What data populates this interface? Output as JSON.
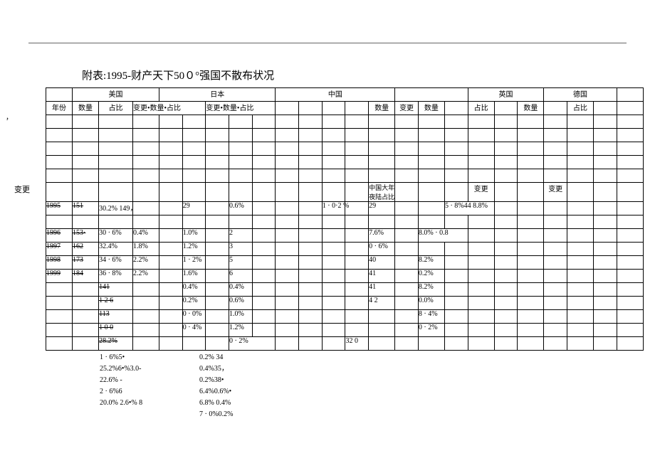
{
  "title": "附表:1995-财产天下50０°强国不散布状况",
  "side_label": "变更",
  "comma1": "，",
  "countries": {
    "us": "美国",
    "jp": "日本",
    "cn": "中国",
    "uk": "英国",
    "de": "德国"
  },
  "headers": {
    "year": "年份",
    "qty": "数量",
    "ratio": "占比",
    "chg_qty_ratio": "变更•数量•占比",
    "change": "变更"
  },
  "cn_block": "中国大年夜陆占比",
  "chart_data": {
    "type": "table",
    "title": "1995- 财产天下500强国不散布状况",
    "rows": [
      {
        "year": "1995",
        "us_qty": "151",
        "us_ratio": "30.2% 149，",
        "jp_a": "29",
        "jp_b": "0.6%",
        "mid": "1 · 0·2 %",
        "cn_qty": "29",
        "uk": "5 · 8%44 8.8%"
      },
      {
        "year": "1996",
        "us_qty": "153·",
        "us_ratio": "30 · 6%",
        "jp_a": "0.4%",
        "jp_b": "1.0%",
        "jp_c": "2",
        "cn": "7.6%",
        "uk": "8.0% · 0.8"
      },
      {
        "year": "1997",
        "us_qty": "162",
        "us_ratio": "32.4%",
        "jp_a": "1.8%",
        "jp_b": "1.2%",
        "jp_c": "3",
        "cn": "0 · 6%",
        "uk": ""
      },
      {
        "year": "1998",
        "us_qty": "173",
        "us_ratio": "34 · 6%",
        "jp_a": "2.2%",
        "jp_b": "1 · 2%",
        "jp_c": "5",
        "cn": "40",
        "uk": "8.2%"
      },
      {
        "year": "1999",
        "us_qty": "184",
        "us_ratio": "36 · 8%",
        "jp_a": "2.2%",
        "jp_b": "1.6%",
        "jp_c": "6",
        "cn": "41",
        "uk": "0.2%"
      },
      {
        "us_qty": "",
        "us_ratio": "141",
        "jp_b": "0.4%",
        "jp_c": "0.4%",
        "cn": "41",
        "uk": "8.2%"
      },
      {
        "us_ratio": "1 2 6",
        "jp_b": "0.2%",
        "jp_c": "0.6%",
        "cn": "4 2",
        "uk": "0.0%"
      },
      {
        "us_ratio": "113",
        "jp_b": "0 · 0%",
        "jp_c": "1.0%",
        "uk": "8 · 4%"
      },
      {
        "us_ratio": "1 0 0",
        "jp_b": "0 · 4%",
        "jp_c": "1.2%",
        "uk": "0 · 2%"
      },
      {
        "us_ratio": "28.2%",
        "jp_c": "0 · 2%",
        "cn": "32 0"
      }
    ]
  },
  "below_left": [
    "1 · 6%5•",
    "25.2%6•%3.0-",
    "22.6%  -",
    "2 · 6%6",
    "20.0% 2.6•% 8"
  ],
  "below_right": [
    "0.2%   34",
    "0.4%35，",
    "0.2%38•",
    "6.4%0.6%•",
    "6.8%  0.4%",
    "7 · 0%0.2%"
  ]
}
